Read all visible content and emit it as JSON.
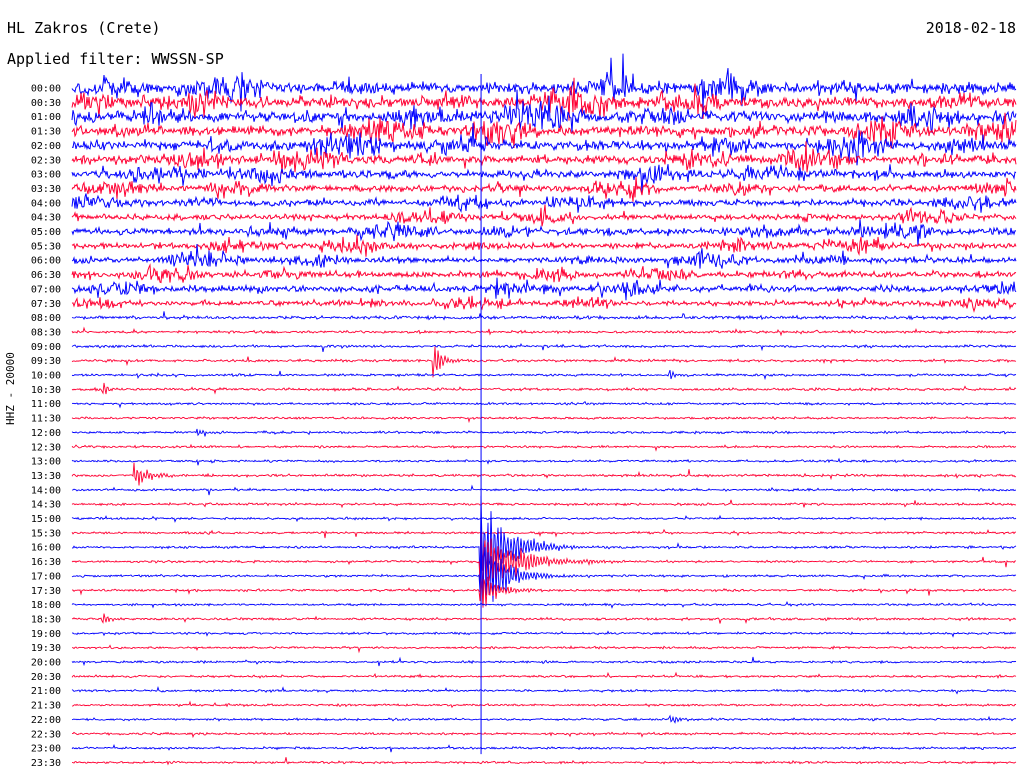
{
  "header": {
    "station": "HL Zakros (Crete)",
    "date": "2018-02-18",
    "filter": "Applied filter: WWSSN-SP",
    "channel": "HHZ - 20000"
  },
  "chart_data": {
    "type": "helicorder",
    "title": "HL Zakros (Crete)",
    "date": "2018-02-18",
    "filter": "WWSSN-SP",
    "ylabel": "HHZ - 20000",
    "row_minutes": 30,
    "row_labels": [
      "00:00",
      "00:30",
      "01:00",
      "01:30",
      "02:00",
      "02:30",
      "03:00",
      "03:30",
      "04:00",
      "04:30",
      "05:00",
      "05:30",
      "06:00",
      "06:30",
      "07:00",
      "07:30",
      "08:00",
      "08:30",
      "09:00",
      "09:30",
      "10:00",
      "10:30",
      "11:00",
      "11:30",
      "12:00",
      "12:30",
      "13:00",
      "13:30",
      "14:00",
      "14:30",
      "15:00",
      "15:30",
      "16:00",
      "16:30",
      "17:00",
      "17:30",
      "18:00",
      "18:30",
      "19:00",
      "19:30",
      "20:00",
      "20:30",
      "21:00",
      "21:30",
      "22:00",
      "22:30",
      "23:00",
      "23:30"
    ],
    "colors": {
      "even_rows": "#0000ff",
      "odd_rows": "#ff0033"
    },
    "noise_level_by_row": [
      1.0,
      1.0,
      1.0,
      0.9,
      0.85,
      0.8,
      0.7,
      0.6,
      0.55,
      0.5,
      0.6,
      0.55,
      0.5,
      0.55,
      0.55,
      0.45,
      0.18,
      0.14,
      0.14,
      0.14,
      0.13,
      0.14,
      0.12,
      0.12,
      0.13,
      0.12,
      0.12,
      0.13,
      0.12,
      0.13,
      0.12,
      0.12,
      0.13,
      0.12,
      0.12,
      0.13,
      0.12,
      0.13,
      0.12,
      0.12,
      0.12,
      0.12,
      0.12,
      0.12,
      0.12,
      0.12,
      0.12,
      0.12
    ],
    "events": [
      {
        "row": 32,
        "minute": 13.0,
        "amplitude": 60,
        "decay_minutes": 2.5
      },
      {
        "row": 33,
        "minute": 13.0,
        "amplitude": 45,
        "decay_minutes": 3.0
      },
      {
        "row": 34,
        "minute": 13.0,
        "amplitude": 55,
        "decay_minutes": 2.0
      },
      {
        "row": 35,
        "minute": 13.0,
        "amplitude": 25,
        "decay_minutes": 1.5
      },
      {
        "row": 19,
        "minute": 11.5,
        "amplitude": 20,
        "decay_minutes": 0.8
      },
      {
        "row": 27,
        "minute": 2.0,
        "amplitude": 14,
        "decay_minutes": 1.5
      },
      {
        "row": 20,
        "minute": 19.0,
        "amplitude": 8,
        "decay_minutes": 0.5
      },
      {
        "row": 21,
        "minute": 1.0,
        "amplitude": 8,
        "decay_minutes": 0.5
      },
      {
        "row": 37,
        "minute": 1.0,
        "amplitude": 8,
        "decay_minutes": 0.5
      },
      {
        "row": 44,
        "minute": 19.0,
        "amplitude": 5,
        "decay_minutes": 1.0
      },
      {
        "row": 24,
        "minute": 4.0,
        "amplitude": 7,
        "decay_minutes": 0.5
      }
    ]
  }
}
